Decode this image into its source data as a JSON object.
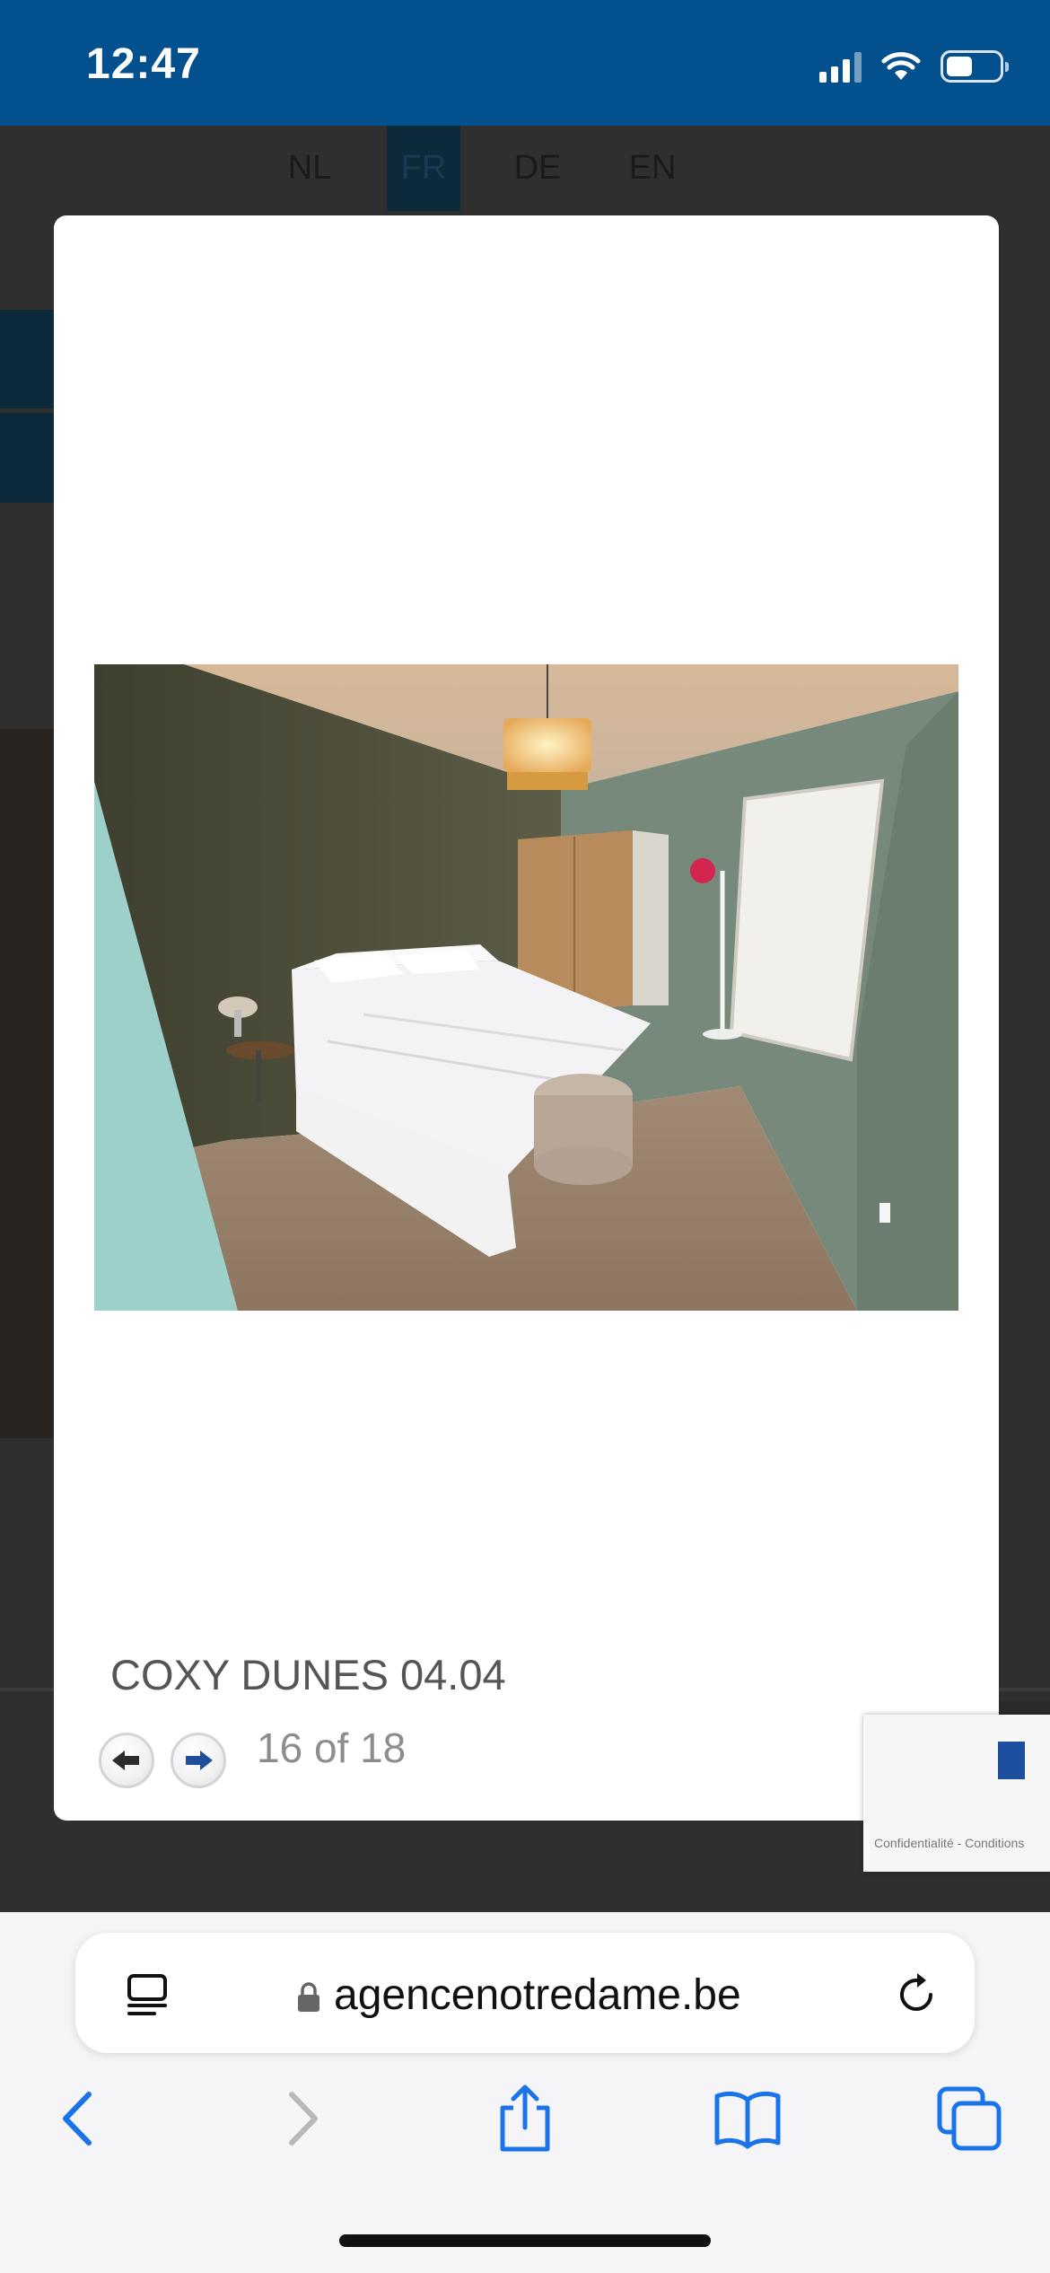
{
  "status_bar": {
    "time": "12:47"
  },
  "languages": [
    {
      "label": "NL",
      "active": false
    },
    {
      "label": "FR",
      "active": true
    },
    {
      "label": "DE",
      "active": false
    },
    {
      "label": "EN",
      "active": false
    }
  ],
  "lightbox": {
    "caption": "COXY DUNES 04.04",
    "counter": "16 of 18"
  },
  "recaptcha": {
    "links": "Confidentialité - Conditions"
  },
  "browser": {
    "url": "agencenotredame.be"
  }
}
